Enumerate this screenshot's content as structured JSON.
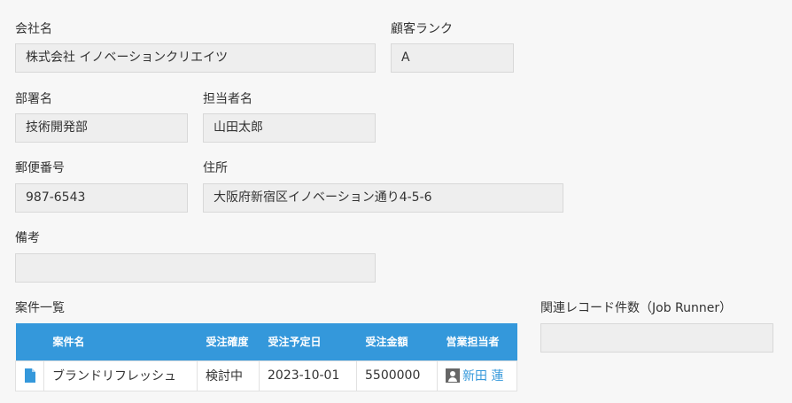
{
  "fields": {
    "company": {
      "label": "会社名",
      "value": "株式会社 イノベーションクリエイツ"
    },
    "rank": {
      "label": "顧客ランク",
      "value": "A"
    },
    "department": {
      "label": "部署名",
      "value": "技術開発部"
    },
    "contact": {
      "label": "担当者名",
      "value": "山田太郎"
    },
    "postal": {
      "label": "郵便番号",
      "value": "987-6543"
    },
    "address": {
      "label": "住所",
      "value": "大阪府新宿区イノベーション通り4-5-6"
    },
    "notes": {
      "label": "備考",
      "value": ""
    },
    "related_count": {
      "label": "関連レコード件数（Job Runner）",
      "value": ""
    }
  },
  "deals_table": {
    "title": "案件一覧",
    "headers": {
      "name": "案件名",
      "status": "受注確度",
      "date": "受注予定日",
      "amount": "受注金額",
      "owner": "営業担当者"
    },
    "rows": [
      {
        "icon": "file-icon",
        "name": "ブランドリフレッシュ",
        "status": "検討中",
        "date": "2023-10-01",
        "amount": "5500000",
        "owner": "新田 蓮"
      }
    ]
  },
  "colors": {
    "header_bg": "#3498db",
    "link": "#3498db",
    "field_bg": "#eeeeee",
    "page_bg": "#f7f7f7"
  }
}
